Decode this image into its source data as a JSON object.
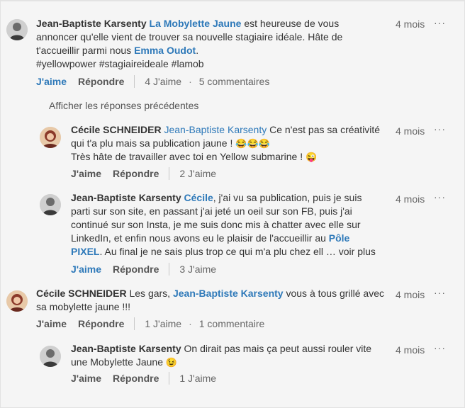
{
  "post": {
    "author": "Jean-Baptiste Karsenty",
    "mention_company": "La Mobylette Jaune",
    "text_1": " est heureuse de vous",
    "text_2": "annoncer qu'elle vient de trouver sa nouvelle stagiaire idéale. Hâte de",
    "text_3": "t'accueillir parmi nous ",
    "mention_person": "Emma Oudot",
    "text_3b": ".",
    "hashtags": "#yellowpower #stagiaireideale #lamob",
    "time": "4 mois",
    "menu": "···",
    "like": "J'aime",
    "reply": "Répondre",
    "likes_count": "4 J'aime",
    "comments_count": "5 commentaires"
  },
  "prev_link": "Afficher les réponses précédentes",
  "reply1": {
    "author": "Cécile SCHNEIDER",
    "mention": "Jean-Baptiste Karsenty",
    "text_1": " Ce n'est pas sa créativité",
    "text_2": "qui t'a plu mais sa publication jaune ! ",
    "emoji_laugh": "😂😂😂",
    "text_3": "Très hâte de travailler avec toi en Yellow submarine ! ",
    "emoji_tongue": "😜",
    "time": "4 mois",
    "menu": "···",
    "like": "J'aime",
    "reply": "Répondre",
    "likes_count": "2 J'aime"
  },
  "reply2": {
    "author": "Jean-Baptiste Karsenty",
    "mention": "Cécile",
    "text_1": ", j'ai vu sa publication, puis je suis",
    "text_2": "parti sur son site, en passant j'ai jeté un oeil sur son FB, puis j'ai",
    "text_3": "continué  sur son Insta, je me suis donc mis à chatter avec elle sur",
    "text_4": "LinkedIn, et enfin nous avons eu le plaisir de l'accueillir au ",
    "mention_2": "Pôle",
    "mention_3": "PIXEL",
    "text_5": ". Au final je ne sais plus trop ce qui m'a plu chez ell",
    "see_more": "… voir plus",
    "time": "4 mois",
    "menu": "···",
    "like": "J'aime",
    "reply": "Répondre",
    "likes_count": "3 J'aime"
  },
  "comment2": {
    "author": "Cécile SCHNEIDER",
    "text_1": " Les gars, ",
    "mention": "Jean-Baptiste Karsenty",
    "text_2": " vous à tous grillé avec",
    "text_3": "sa mobylette jaune !!!",
    "time": "4 mois",
    "menu": "···",
    "like": "J'aime",
    "reply": "Répondre",
    "likes_count": "1 J'aime",
    "comments_count": "1 commentaire"
  },
  "reply3": {
    "author": "Jean-Baptiste Karsenty",
    "text_1": " On dirait pas mais ça peut aussi rouler vite",
    "text_2": "une Mobylette Jaune ",
    "emoji_wink": "😉",
    "time": "4 mois",
    "menu": "···",
    "like": "J'aime",
    "reply": "Répondre",
    "likes_count": "1 J'aime"
  },
  "colors": {
    "link": "#2e79b9",
    "text": "#333333",
    "muted": "#666666",
    "background": "#f5f5f5"
  },
  "icons": {
    "menu": "ellipsis-icon",
    "avatar_male": "avatar-male",
    "avatar_female": "avatar-female"
  }
}
